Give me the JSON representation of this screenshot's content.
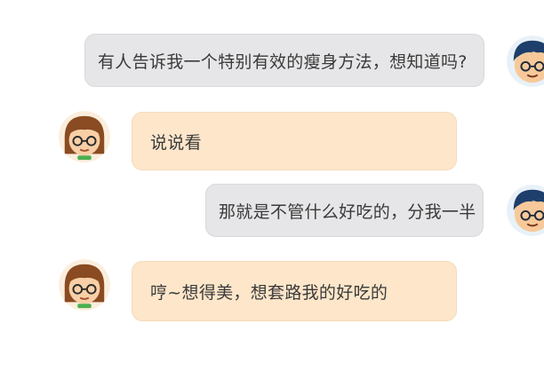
{
  "messages": [
    {
      "sender": "boy",
      "text": "有人告诉我一个特别有效的瘦身方法，想知道吗?"
    },
    {
      "sender": "girl",
      "text": "说说看"
    },
    {
      "sender": "boy",
      "text": "那就是不管什么好吃的，分我一半"
    },
    {
      "sender": "girl",
      "text": "哼~想得美，想套路我的好吃的"
    }
  ],
  "colors": {
    "boy_bubble": "#e6e6e8",
    "girl_bubble": "#fde6ca"
  }
}
